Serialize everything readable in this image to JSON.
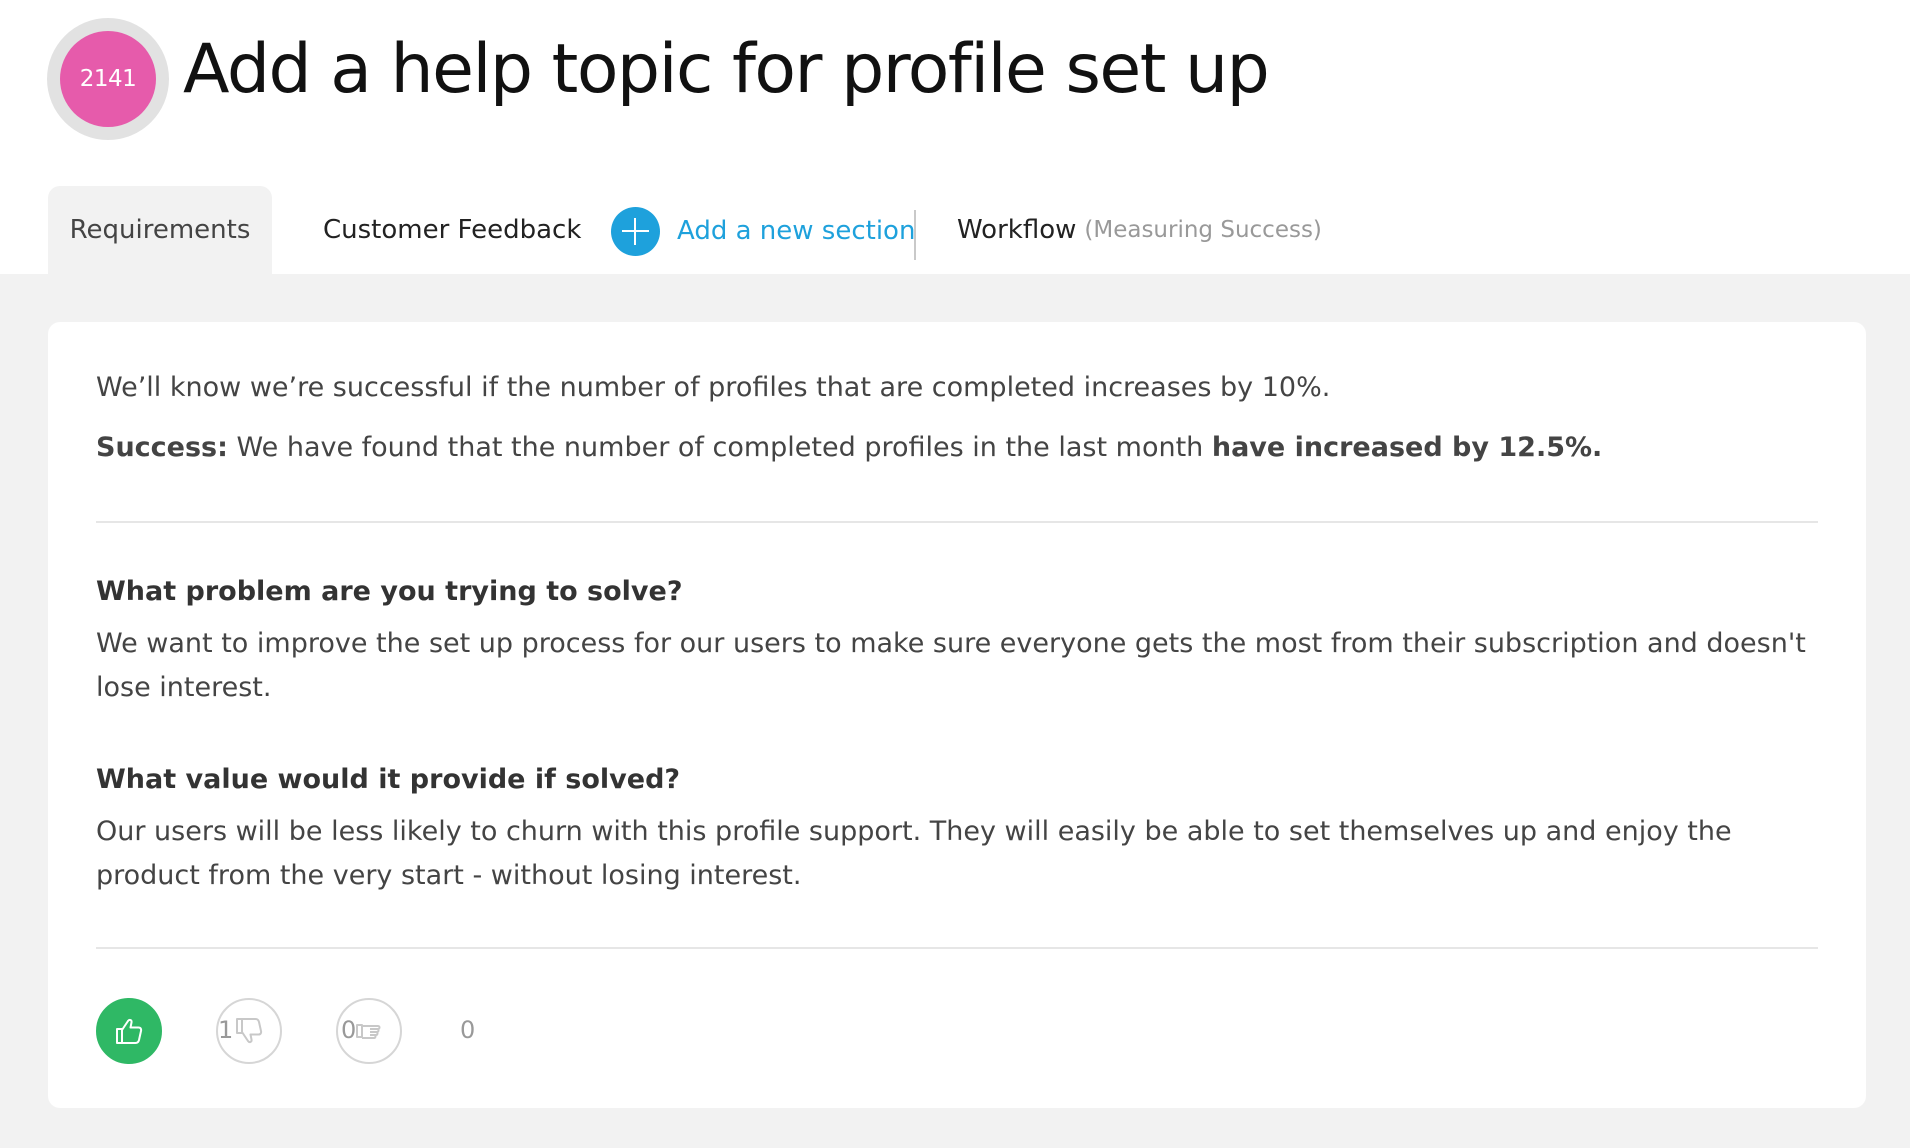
{
  "idea": {
    "number": "2141",
    "title": "Add a help topic for profile set up",
    "badge_color": "#e65bab"
  },
  "tabs": [
    {
      "label": "Requirements",
      "active": true
    },
    {
      "label": "Customer Feedback",
      "active": false
    }
  ],
  "add_section": {
    "label": "Add a new section",
    "icon": "plus-circle-icon",
    "color": "#1ea1dc"
  },
  "workflow_tab": {
    "label": "Workflow",
    "sub_label": "(Measuring Success)"
  },
  "success": {
    "statement": "We’ll know we’re successful if the number of profiles that are completed increases by 10%.",
    "result_label": "Success:",
    "result_text": " We have found that the number of completed profiles in the last month ",
    "result_emphasis": "have increased by 12.5%."
  },
  "questions": [
    {
      "question": "What problem are you trying to solve?",
      "answer": "We want to improve the set up process for our users to make sure everyone gets the most from their subscription and doesn't lose interest."
    },
    {
      "question": "What value would it provide if solved?",
      "answer": "Our users will be less likely to churn with this profile support. They will easily be able to set themselves up and enjoy the product from the very start - without losing interest."
    }
  ],
  "reactions": [
    {
      "icon": "thumbs-up-icon",
      "count": "1",
      "active": true,
      "color": "#2fb865"
    },
    {
      "icon": "thumbs-down-icon",
      "count": "0",
      "active": false
    },
    {
      "icon": "thumbs-sideways-icon",
      "count": "0",
      "active": false
    }
  ]
}
